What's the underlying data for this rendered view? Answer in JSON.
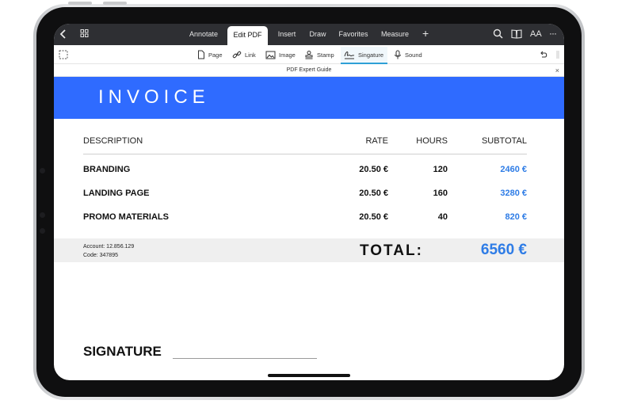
{
  "topbar": {
    "tabs": [
      {
        "label": "Annotate"
      },
      {
        "label": "Edit PDF",
        "active": true
      },
      {
        "label": "Insert"
      },
      {
        "label": "Draw"
      },
      {
        "label": "Favorites"
      },
      {
        "label": "Measure"
      }
    ],
    "icons": [
      "back-icon",
      "grid-icon",
      "add-tab-icon",
      "search-icon",
      "book-icon",
      "text-size-icon",
      "more-icon"
    ],
    "add_label": "+",
    "text_size_label": "AA",
    "more_label": "···"
  },
  "toolbar": {
    "items": [
      {
        "label": "Page",
        "icon": "page-icon"
      },
      {
        "label": "Link",
        "icon": "link-icon"
      },
      {
        "label": "Image",
        "icon": "image-icon"
      },
      {
        "label": "Stamp",
        "icon": "stamp-icon"
      },
      {
        "label": "Singature",
        "icon": "signature-icon",
        "active": true
      },
      {
        "label": "Sound",
        "icon": "microphone-icon"
      }
    ],
    "undo_icon": "undo-icon",
    "select_icon": "selection-icon"
  },
  "document": {
    "tab_title": "PDF Expert Guide",
    "close_label": "×"
  },
  "invoice": {
    "title": "INVOICE",
    "columns": [
      "DESCRIPTION",
      "RATE",
      "HOURS",
      "SUBTOTAL"
    ],
    "rows": [
      {
        "description": "BRANDING",
        "rate": "20.50 €",
        "hours": "120",
        "subtotal": "2460 €"
      },
      {
        "description": "LANDING PAGE",
        "rate": "20.50 €",
        "hours": "160",
        "subtotal": "3280 €"
      },
      {
        "description": "PROMO MATERIALS",
        "rate": "20.50 €",
        "hours": "40",
        "subtotal": "820 €"
      }
    ],
    "account": "Account:  12.856.129",
    "code": "Code:  347895",
    "total_label": "TOTAL:",
    "total_value": "6560 €",
    "signature_label": "SIGNATURE"
  },
  "colors": {
    "banner": "#2f6bff",
    "accent_blue": "#2e7ce6",
    "topbar": "#2e2f33",
    "active_tool_underline": "#2ea0d6"
  }
}
